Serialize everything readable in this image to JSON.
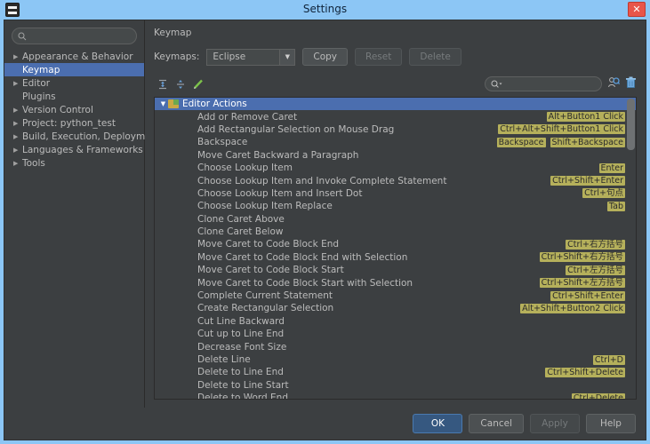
{
  "window": {
    "title": "Settings",
    "app_icon": "pycharm-icon",
    "close_label": "✕",
    "accent_title_bar": "#8cc6f5",
    "background": "#3c3f41",
    "selection_color": "#4b6eaf",
    "shortcut_badge_color": "#b5b05b"
  },
  "sidebar": {
    "search": {
      "value": "",
      "placeholder": "",
      "icon": "search-icon"
    },
    "items": [
      {
        "label": "Appearance & Behavior",
        "expandable": true,
        "selected": false
      },
      {
        "label": "Keymap",
        "expandable": false,
        "selected": true
      },
      {
        "label": "Editor",
        "expandable": true,
        "selected": false
      },
      {
        "label": "Plugins",
        "expandable": false,
        "selected": false
      },
      {
        "label": "Version Control",
        "expandable": true,
        "selected": false
      },
      {
        "label": "Project: python_test",
        "expandable": true,
        "selected": false
      },
      {
        "label": "Build, Execution, Deployment",
        "expandable": true,
        "selected": false
      },
      {
        "label": "Languages & Frameworks",
        "expandable": true,
        "selected": false
      },
      {
        "label": "Tools",
        "expandable": true,
        "selected": false
      }
    ]
  },
  "main": {
    "pane_title": "Keymap",
    "keymaps_label": "Keymaps:",
    "keymap_selected": "Eclipse",
    "buttons": {
      "copy": "Copy",
      "reset": "Reset",
      "delete": "Delete"
    },
    "toolbar_icons": [
      "expand-all-icon",
      "collapse-all-icon",
      "edit-shortcut-icon"
    ],
    "shortcut_search": {
      "value": "",
      "placeholder": "",
      "icon": "search-dropdown-icon"
    },
    "right_icons": [
      "find-by-shortcut-icon",
      "delete-shortcut-icon"
    ],
    "tree": {
      "root": {
        "label": "Editor Actions",
        "expanded": true,
        "selected": true,
        "icon": "folder-icon"
      },
      "rows": [
        {
          "label": "Add or Remove Caret",
          "shortcuts": [
            "Alt+Button1 Click"
          ]
        },
        {
          "label": "Add Rectangular Selection on Mouse Drag",
          "shortcuts": [
            "Ctrl+Alt+Shift+Button1 Click"
          ]
        },
        {
          "label": "Backspace",
          "shortcuts": [
            "Backspace",
            "Shift+Backspace"
          ]
        },
        {
          "label": "Move Caret Backward a Paragraph",
          "shortcuts": []
        },
        {
          "label": "Choose Lookup Item",
          "shortcuts": [
            "Enter"
          ]
        },
        {
          "label": "Choose Lookup Item and Invoke Complete Statement",
          "shortcuts": [
            "Ctrl+Shift+Enter"
          ]
        },
        {
          "label": "Choose Lookup Item and Insert Dot",
          "shortcuts": [
            "Ctrl+句点"
          ]
        },
        {
          "label": "Choose Lookup Item Replace",
          "shortcuts": [
            "Tab"
          ]
        },
        {
          "label": "Clone Caret Above",
          "shortcuts": []
        },
        {
          "label": "Clone Caret Below",
          "shortcuts": []
        },
        {
          "label": "Move Caret to Code Block End",
          "shortcuts": [
            "Ctrl+右方括号"
          ]
        },
        {
          "label": "Move Caret to Code Block End with Selection",
          "shortcuts": [
            "Ctrl+Shift+右方括号"
          ]
        },
        {
          "label": "Move Caret to Code Block Start",
          "shortcuts": [
            "Ctrl+左方括号"
          ]
        },
        {
          "label": "Move Caret to Code Block Start with Selection",
          "shortcuts": [
            "Ctrl+Shift+左方括号"
          ]
        },
        {
          "label": "Complete Current Statement",
          "shortcuts": [
            "Ctrl+Shift+Enter"
          ]
        },
        {
          "label": "Create Rectangular Selection",
          "shortcuts": [
            "Alt+Shift+Button2 Click"
          ]
        },
        {
          "label": "Cut Line Backward",
          "shortcuts": []
        },
        {
          "label": "Cut up to Line End",
          "shortcuts": []
        },
        {
          "label": "Decrease Font Size",
          "shortcuts": []
        },
        {
          "label": "Delete Line",
          "shortcuts": [
            "Ctrl+D"
          ]
        },
        {
          "label": "Delete to Line End",
          "shortcuts": [
            "Ctrl+Shift+Delete"
          ]
        },
        {
          "label": "Delete to Line Start",
          "shortcuts": []
        },
        {
          "label": "Delete to Word End",
          "shortcuts": [
            "Ctrl+Delete"
          ]
        }
      ]
    }
  },
  "footer": {
    "ok": "OK",
    "cancel": "Cancel",
    "apply": "Apply",
    "help": "Help"
  }
}
